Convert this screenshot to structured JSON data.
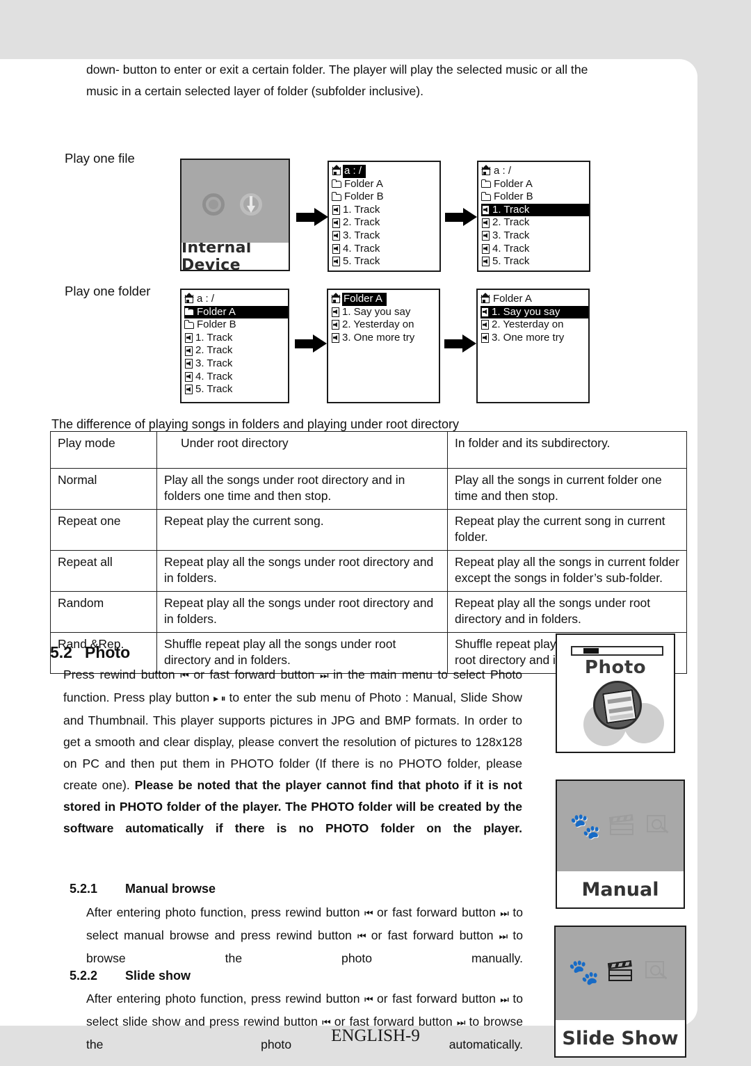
{
  "document": {
    "footer": "ENGLISH-9"
  },
  "intro": {
    "line1": "down- button to enter or exit a certain folder. The player will play the selected music or all the",
    "line2": "music in a certain selected layer of folder (subfolder inclusive)."
  },
  "flow": {
    "row1_label": "Play one file",
    "row2_label": "Play one folder",
    "internal_device": {
      "caption": "Internal Device",
      "icons": [
        "usb-sync-icon",
        "usb-download-icon"
      ]
    },
    "screen_root_a": {
      "items": [
        {
          "icon": "home-icon",
          "text": "a : /",
          "selected": true
        },
        {
          "icon": "folder-icon",
          "text": "Folder A",
          "selected": false
        },
        {
          "icon": "folder-icon",
          "text": "Folder B",
          "selected": false
        },
        {
          "icon": "music-file-icon",
          "text": "1. Track",
          "selected": false
        },
        {
          "icon": "music-file-icon",
          "text": "2. Track",
          "selected": false
        },
        {
          "icon": "music-file-icon",
          "text": "3. Track",
          "selected": false
        },
        {
          "icon": "music-file-icon",
          "text": "4. Track",
          "selected": false
        },
        {
          "icon": "music-file-icon",
          "text": "5. Track",
          "selected": false
        }
      ]
    },
    "screen_root_b": {
      "items": [
        {
          "icon": "home-icon",
          "text": "a : /",
          "selected": false
        },
        {
          "icon": "folder-icon",
          "text": "Folder A",
          "selected": false
        },
        {
          "icon": "folder-icon",
          "text": "Folder B",
          "selected": false
        },
        {
          "icon": "music-file-icon",
          "text": "1. Track",
          "selected": true
        },
        {
          "icon": "music-file-icon",
          "text": "2. Track",
          "selected": false
        },
        {
          "icon": "music-file-icon",
          "text": "3. Track",
          "selected": false
        },
        {
          "icon": "music-file-icon",
          "text": "4. Track",
          "selected": false
        },
        {
          "icon": "music-file-icon",
          "text": "5. Track",
          "selected": false
        }
      ]
    },
    "screen_folder_a": {
      "items": [
        {
          "icon": "home-icon",
          "text": "a : /",
          "selected": false
        },
        {
          "icon": "folder-icon",
          "text": "Folder A",
          "selected": true
        },
        {
          "icon": "folder-icon",
          "text": "Folder B",
          "selected": false
        },
        {
          "icon": "music-file-icon",
          "text": "1. Track",
          "selected": false
        },
        {
          "icon": "music-file-icon",
          "text": "2. Track",
          "selected": false
        },
        {
          "icon": "music-file-icon",
          "text": "3. Track",
          "selected": false
        },
        {
          "icon": "music-file-icon",
          "text": "4. Track",
          "selected": false
        },
        {
          "icon": "music-file-icon",
          "text": "5. Track",
          "selected": false
        }
      ]
    },
    "screen_folder_b": {
      "items": [
        {
          "icon": "home-icon",
          "text": "Folder A",
          "selected": true
        },
        {
          "icon": "music-file-icon",
          "text": "1. Say you say",
          "selected": false
        },
        {
          "icon": "music-file-icon",
          "text": "2. Yesterday on",
          "selected": false
        },
        {
          "icon": "music-file-icon",
          "text": "3. One more try",
          "selected": false
        }
      ]
    },
    "screen_folder_c": {
      "items": [
        {
          "icon": "home-icon",
          "text": "Folder A",
          "selected": false
        },
        {
          "icon": "music-file-icon",
          "text": "1. Say you say",
          "selected": true
        },
        {
          "icon": "music-file-icon",
          "text": "2. Yesterday on",
          "selected": false
        },
        {
          "icon": "music-file-icon",
          "text": "3. One more try",
          "selected": false
        }
      ]
    }
  },
  "table": {
    "caption": "The difference of playing songs in folders and playing under root directory",
    "headers": [
      "Play mode",
      "Under root directory",
      "In folder and its subdirectory."
    ],
    "rows": [
      {
        "mode": "Normal",
        "root": "Play all the songs under root directory and in folders one time and then stop.",
        "folder": "Play all the songs in current folder one time and then stop."
      },
      {
        "mode": "Repeat one",
        "root": "Repeat play the current song.",
        "folder": "Repeat play the current song in current folder."
      },
      {
        "mode": "Repeat all",
        "root": "Repeat play all the songs under root directory and in folders.",
        "folder": "Repeat play all the songs in current folder except the songs in folder’s sub-folder."
      },
      {
        "mode": "Random",
        "root": "Repeat play all the songs under root directory and in folders.",
        "folder": "Repeat play all the songs under root directory and in folders."
      },
      {
        "mode": "Rand.&Rep.",
        "root": "Shuffle repeat play all the songs under root directory and in folders.",
        "folder": "Shuffle repeat play all the songs under root directory and in folders."
      }
    ]
  },
  "section": {
    "number": "5.2",
    "title": "Photo",
    "p_a": "Press rewind button",
    "p_b": "or fast forward button",
    "p_c": "in the main menu to select Photo function. Press play button",
    "p_d": "to enter the sub menu of Photo : Manual,  Slide Show and Thumbnail. This player supports pictures in JPG and BMP formats. In order to get a smooth and clear display, please convert the resolution of pictures to 128x128 on PC and then put them in PHOTO folder (If there is no PHOTO folder, please create one).",
    "p_bold": "Please be noted that the player cannot find that photo if it is not stored in PHOTO folder of the player. The PHOTO folder will be created by the software automatically if there is no PHOTO folder on the player.",
    "glyph_rewind": "⏮",
    "glyph_forward": "⏭",
    "glyph_play": "▸ ⏸"
  },
  "sub1": {
    "number": "5.2.1",
    "title": "Manual browse",
    "t_a": "After entering photo function, press rewind button",
    "t_b": "or fast forward button",
    "t_c": "to select manual browse and press rewind button",
    "t_d": "or fast forward button",
    "t_e": "to browse the photo manually."
  },
  "sub2": {
    "number": "5.2.2",
    "title": "Slide show",
    "t_a": "After entering photo function, press rewind button",
    "t_b": "or fast forward button",
    "t_c": "to select slide show and press rewind button",
    "t_d": "or fast forward button",
    "t_e": "to browse the photo automatically."
  },
  "right_panels": {
    "photo_menu": {
      "label": "Photo",
      "icon": "photo-disc-icon",
      "battery": "battery-bar-icon"
    },
    "manual": {
      "label": "Manual",
      "icons": [
        "paw-icon",
        "clapper-icon",
        "magnifier-icon"
      ],
      "active": "paw-icon"
    },
    "slide_show": {
      "label": "Slide Show",
      "icons": [
        "paw-icon",
        "clapper-icon",
        "magnifier-icon"
      ],
      "active": "clapper-icon"
    }
  }
}
